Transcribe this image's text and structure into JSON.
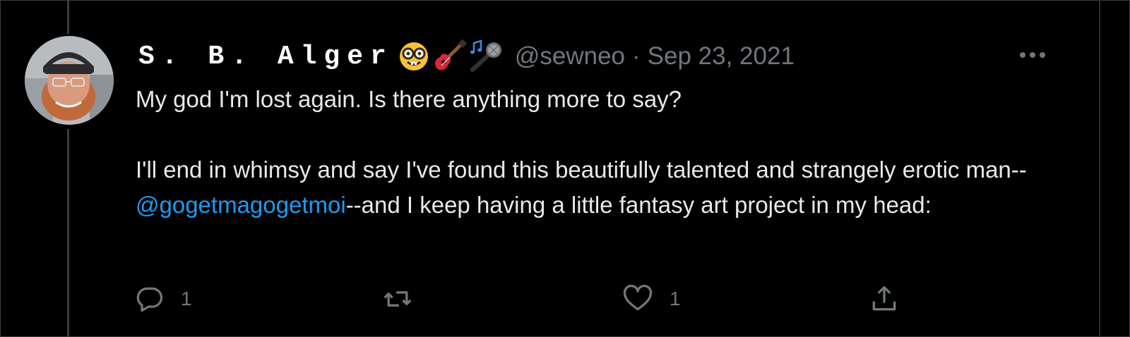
{
  "tweet": {
    "author": {
      "display_name": "S. B. Alger",
      "emojis": [
        "nerd-face-icon",
        "guitar-icon",
        "microphone-icon"
      ],
      "handle": "@sewneo"
    },
    "separator": "·",
    "date": "Sep 23, 2021",
    "text": {
      "paragraph1": "My god I'm lost again.  Is there anything more to say?",
      "paragraph2_before": "I'll end in whimsy and say I've found this beautifully talented and strangely erotic man--",
      "mention": "@gogetmagogetmoi",
      "paragraph2_after": "--and I keep having a little fantasy art project in my head:"
    },
    "actions": {
      "reply_count": "1",
      "retweet_count": "",
      "like_count": "1"
    }
  },
  "colors": {
    "background": "#000000",
    "text": "#e7e9ea",
    "secondary": "#71767b",
    "link": "#1d9bf0",
    "thread_line": "#3a3d40"
  }
}
